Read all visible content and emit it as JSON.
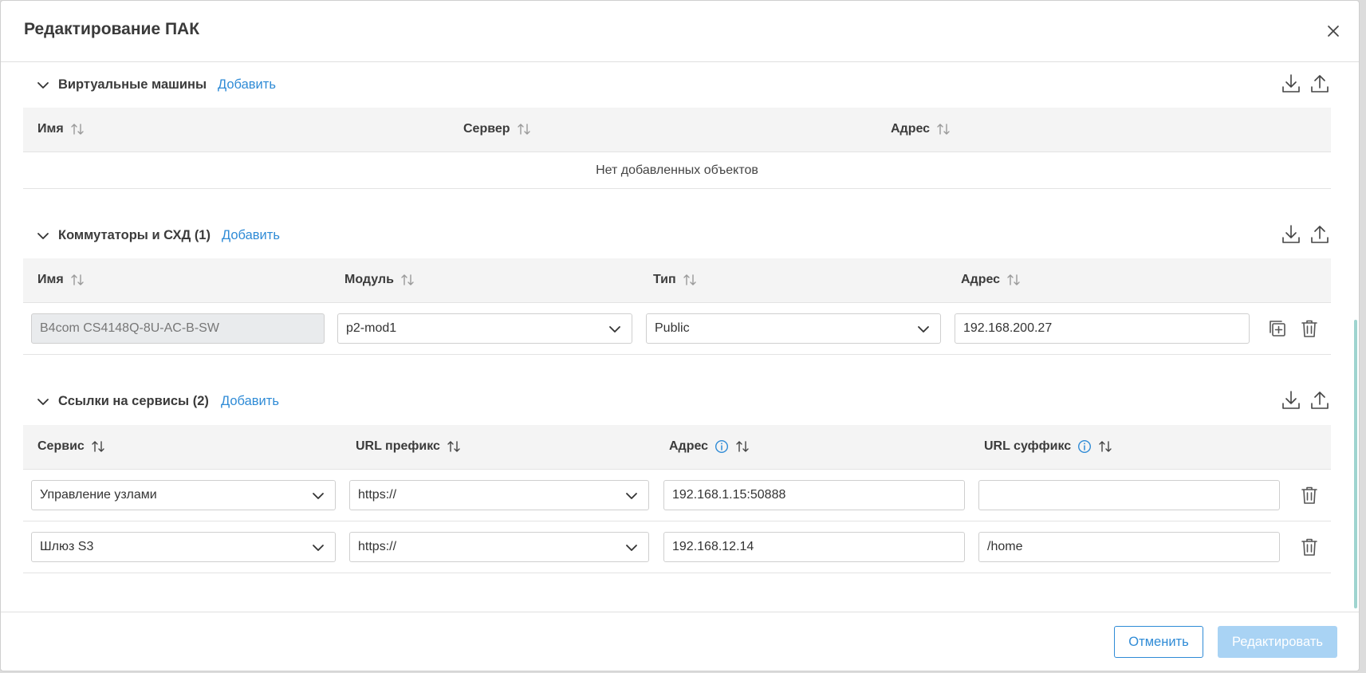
{
  "header": {
    "title": "Редактирование ПАК"
  },
  "sections": {
    "vm": {
      "title": "Виртуальные машины",
      "add_label": "Добавить",
      "columns": [
        "Имя",
        "Сервер",
        "Адрес"
      ],
      "empty_text": "Нет добавленных объектов"
    },
    "switches": {
      "title": "Коммутаторы и СХД (1)",
      "add_label": "Добавить",
      "columns": [
        "Имя",
        "Модуль",
        "Тип",
        "Адрес"
      ],
      "rows": [
        {
          "name": "B4com CS4148Q-8U-AC-B-SW",
          "module": "p2-mod1",
          "type": "Public",
          "address": "192.168.200.27"
        }
      ]
    },
    "links": {
      "title": "Ссылки на сервисы (2)",
      "add_label": "Добавить",
      "columns": [
        "Сервис",
        "URL префикс",
        "Адрес",
        "URL суффикс"
      ],
      "rows": [
        {
          "service": "Управление узлами",
          "prefix": "https://",
          "address": "192.168.1.15:50888",
          "suffix": ""
        },
        {
          "service": "Шлюз S3",
          "prefix": "https://",
          "address": "192.168.12.14",
          "suffix": "/home"
        }
      ]
    }
  },
  "footer": {
    "cancel_label": "Отменить",
    "submit_label": "Редактировать"
  },
  "colors": {
    "accent": "#2f8bd6",
    "submit_disabled": "#a9d3f4",
    "header_bg": "#f4f4f4",
    "scrollbar": "#9fd4cf"
  }
}
